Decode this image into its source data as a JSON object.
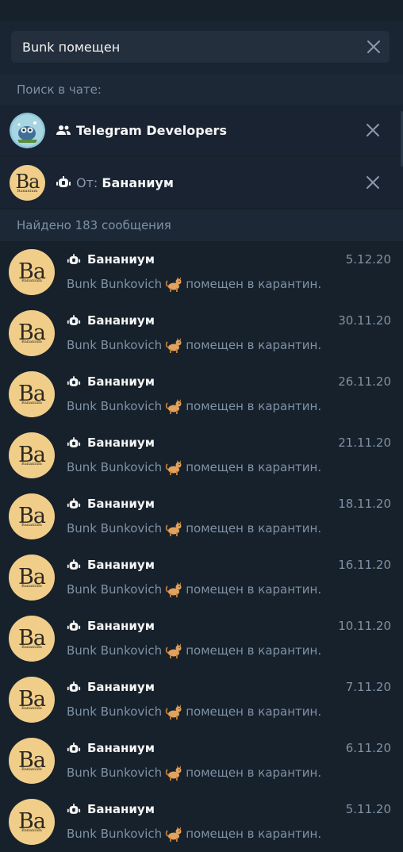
{
  "search": {
    "query": "Bunk помещен"
  },
  "scope_header": "Поиск в чате:",
  "chat_filter": {
    "label": "Telegram Developers"
  },
  "sender_filter": {
    "prefix": "От:",
    "name": "Бананиум"
  },
  "avatar_text": {
    "main": "Ba",
    "sub": "Bananium"
  },
  "found_header": "Найдено 183 сообщения",
  "colors": {
    "background": "#17212b",
    "accent_text": "#f5f5f5",
    "muted_text": "#7f91a4",
    "avatar": "#f0ce8a"
  },
  "results": [
    {
      "sender": "Бананиум",
      "date": "5.12.20",
      "text_before": "Bunk Bunkovich",
      "text_after": "помещен в карантин."
    },
    {
      "sender": "Бананиум",
      "date": "30.11.20",
      "text_before": "Bunk Bunkovich",
      "text_after": "помещен в карантин."
    },
    {
      "sender": "Бананиум",
      "date": "26.11.20",
      "text_before": "Bunk Bunkovich",
      "text_after": "помещен в карантин."
    },
    {
      "sender": "Бананиум",
      "date": "21.11.20",
      "text_before": "Bunk Bunkovich",
      "text_after": "помещен в карантин."
    },
    {
      "sender": "Бананиум",
      "date": "18.11.20",
      "text_before": "Bunk Bunkovich",
      "text_after": "помещен в карантин."
    },
    {
      "sender": "Бананиум",
      "date": "16.11.20",
      "text_before": "Bunk Bunkovich",
      "text_after": "помещен в карантин."
    },
    {
      "sender": "Бананиум",
      "date": "10.11.20",
      "text_before": "Bunk Bunkovich",
      "text_after": "помещен в карантин."
    },
    {
      "sender": "Бананиум",
      "date": "7.11.20",
      "text_before": "Bunk Bunkovich",
      "text_after": "помещен в карантин."
    },
    {
      "sender": "Бананиум",
      "date": "6.11.20",
      "text_before": "Bunk Bunkovich",
      "text_after": "помещен в карантин."
    },
    {
      "sender": "Бананиум",
      "date": "5.11.20",
      "text_before": "Bunk Bunkovich",
      "text_after": "помещен в карантин."
    }
  ]
}
